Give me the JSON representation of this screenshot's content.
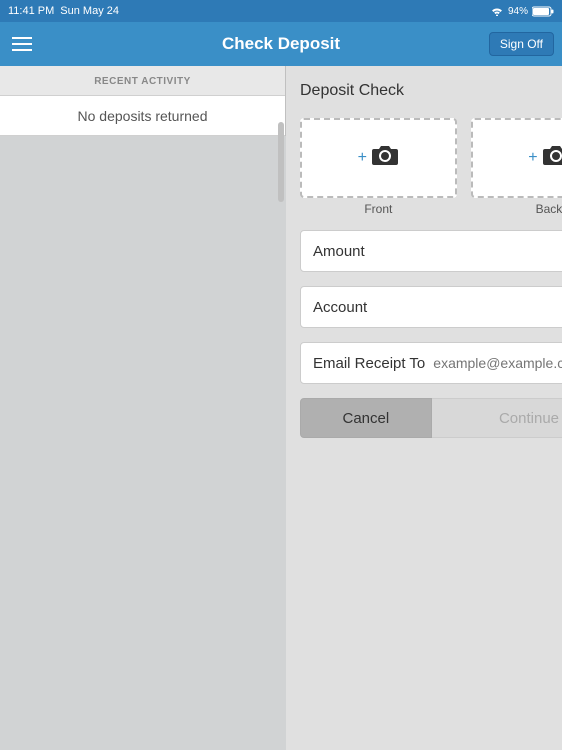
{
  "statusBar": {
    "time": "11:41 PM",
    "date": "Sun May 24",
    "wifi_icon": "wifi",
    "battery_percent": "94%",
    "battery_icon": "battery"
  },
  "navBar": {
    "title": "Check Deposit",
    "signoff_label": "Sign Off",
    "menu_icon": "hamburger"
  },
  "leftPanel": {
    "section_header": "RECENT ACTIVITY",
    "empty_message": "No deposits returned"
  },
  "rightPanel": {
    "section_title": "Deposit Check",
    "front_label": "Front",
    "back_label": "Back",
    "amount_label": "Amount",
    "account_label": "Account",
    "email_label": "Email Receipt To",
    "email_placeholder": "example@example.com",
    "cancel_label": "Cancel",
    "continue_label": "Continue"
  }
}
